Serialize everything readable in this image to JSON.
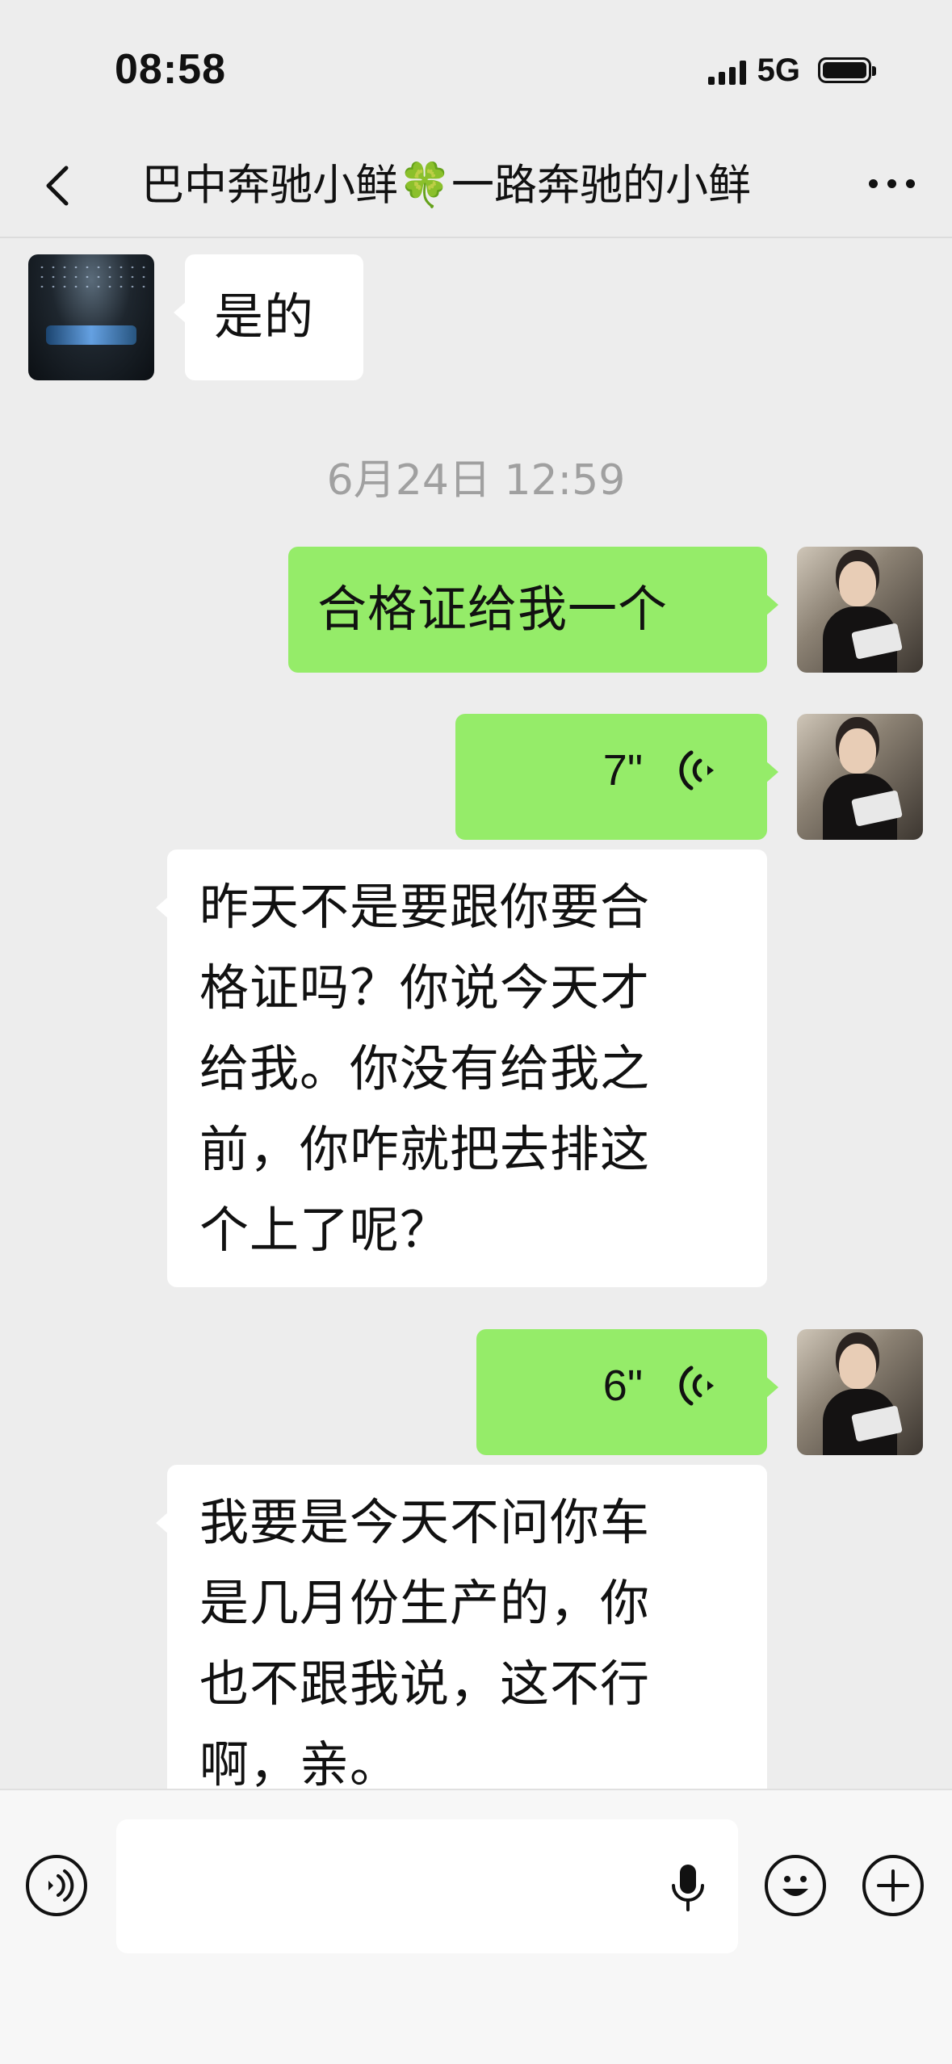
{
  "status_bar": {
    "time": "08:58",
    "network": "5G"
  },
  "header": {
    "title": "巴中奔驰小鲜🍀一路奔驰的小鲜"
  },
  "messages": [
    {
      "type": "text",
      "direction": "in",
      "text": "是的"
    },
    {
      "type": "timestamp",
      "text": "6月24日 12:59"
    },
    {
      "type": "text",
      "direction": "out",
      "text": "合格证给我一个"
    },
    {
      "type": "voice",
      "direction": "out",
      "duration": "7\""
    },
    {
      "type": "text",
      "direction": "in",
      "lines": [
        "昨天不是要跟你要合",
        "格证吗？你说今天才",
        "给我。你没有给我之",
        "前，你咋就把去排这",
        "个上了呢？"
      ]
    },
    {
      "type": "voice",
      "direction": "out",
      "duration": "6\""
    },
    {
      "type": "text",
      "direction": "in",
      "lines": [
        "我要是今天不问你车",
        "是几月份生产的，你",
        "也不跟我说，这不行",
        "啊，亲。"
      ]
    }
  ],
  "colors": {
    "background": "#ededed",
    "outgoing_bubble": "#95ec69",
    "incoming_bubble": "#ffffff",
    "timestamp": "#a0a0a0"
  },
  "icons": {
    "back": "chevron-left-icon",
    "more": "more-dots-icon",
    "voice_toggle": "voice-mode-icon",
    "mic": "microphone-icon",
    "emoji": "emoji-icon",
    "plus": "plus-icon"
  }
}
